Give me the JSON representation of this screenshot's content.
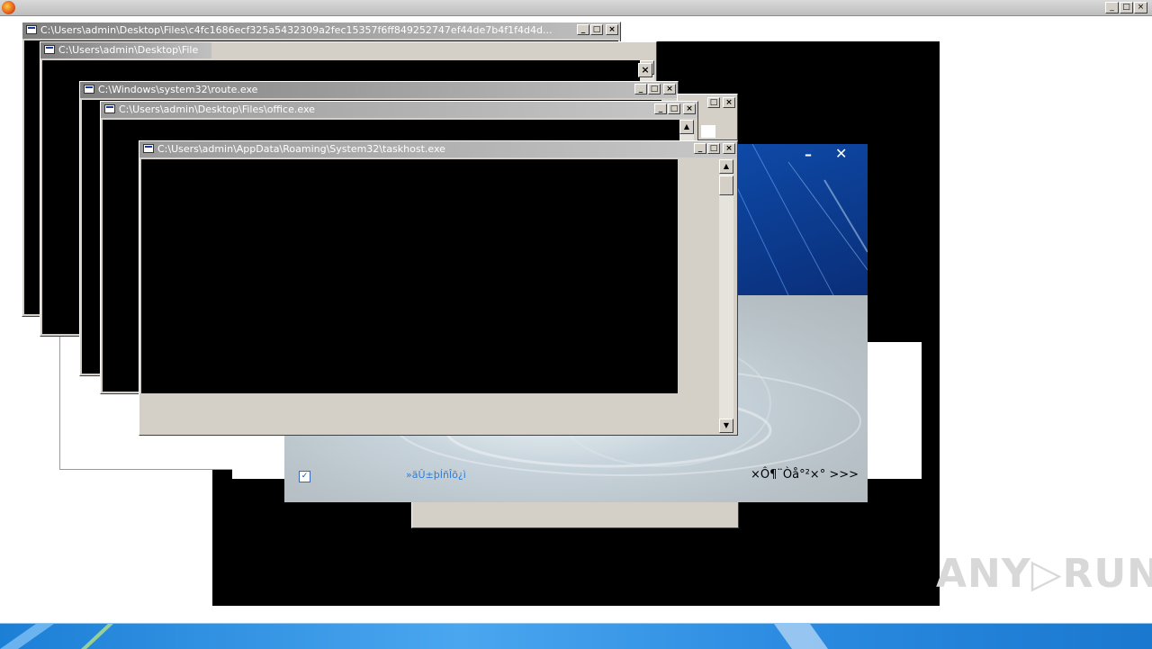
{
  "browser": {
    "title": "",
    "controls": [
      "_",
      "□",
      "×"
    ]
  },
  "windows": {
    "w1": {
      "title": "C:\\Users\\admin\\Desktop\\Files\\c4fc1686ecf325a5432309a2fec15357f6ff849252747ef44de7b4f1f4d4d..."
    },
    "w2": {
      "title": "C:\\Users\\admin\\Desktop\\File"
    },
    "w3": {
      "title": "C:\\Windows\\system32\\route.exe"
    },
    "w4": {
      "title": "C:\\Users\\admin\\Desktop\\Files\\office.exe"
    },
    "w5": {
      "title": "C:\\Users\\admin\\AppData\\Roaming\\System32\\taskhost.exe"
    }
  },
  "installer": {
    "minimize": "–",
    "close": "✕",
    "checkbox_checked": true,
    "link_text": "»äÛ±þÍñÎõ¿ì",
    "next_text": "×Ô¶¨Òå°²×° >>>"
  },
  "watermark": "ANY▷RUN",
  "icons": {
    "browser": "firefox-icon",
    "window": "console-window-icon",
    "scroll_up": "arrow-up-icon",
    "scroll_down": "arrow-down-icon"
  },
  "colors": {
    "console_bg": "#000000",
    "taskbar": "#2a8ae0",
    "installer_top": "#0e4aa8"
  }
}
